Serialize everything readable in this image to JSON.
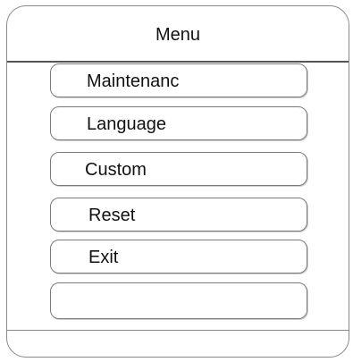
{
  "menu": {
    "title": "Menu",
    "items": [
      {
        "label": "Maintenanc"
      },
      {
        "label": "Language"
      },
      {
        "label": "Custom"
      },
      {
        "label": "Reset"
      },
      {
        "label": "Exit"
      },
      {
        "label": ""
      }
    ]
  },
  "colors": {
    "border": "#8a8a8a",
    "header_divider": "#555555",
    "text": "#111111",
    "background": "#ffffff"
  }
}
